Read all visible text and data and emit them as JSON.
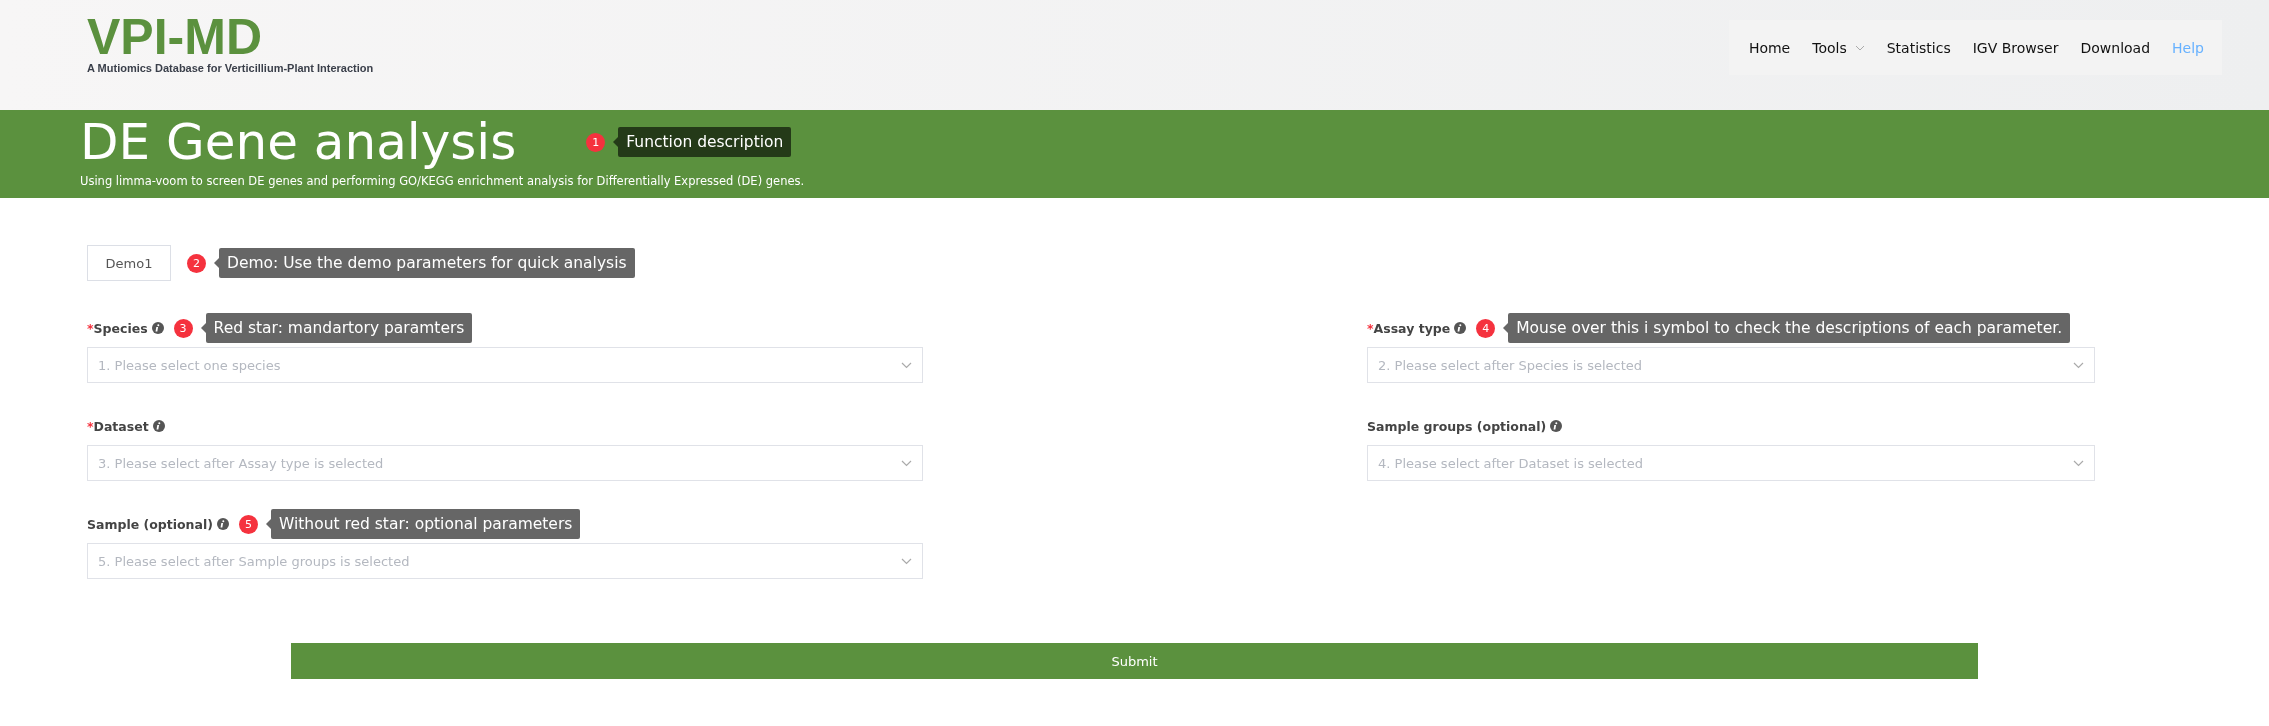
{
  "header": {
    "logo": "VPI-MD",
    "tagline": "A Mutiomics Database for Verticillium-Plant Interaction",
    "nav": [
      {
        "label": "Home",
        "kind": "link",
        "selected": false
      },
      {
        "label": "Tools",
        "kind": "dropdown",
        "selected": false
      },
      {
        "label": "Statistics",
        "kind": "link",
        "selected": false
      },
      {
        "label": "IGV Browser",
        "kind": "link",
        "selected": false
      },
      {
        "label": "Download",
        "kind": "link",
        "selected": false
      },
      {
        "label": "Help",
        "kind": "link",
        "selected": true
      }
    ]
  },
  "banner": {
    "title": "DE Gene analysis",
    "description": "Using limma-voom to screen DE genes and performing GO/KEGG enrichment analysis for Differentially Expressed (DE) genes.",
    "callout": {
      "number": "1",
      "text": "Function description"
    }
  },
  "demo": {
    "label": "Demo1",
    "callout": {
      "number": "2",
      "text": "Demo: Use the demo parameters for quick analysis"
    }
  },
  "fields": [
    {
      "marker": "*",
      "label": "Species",
      "placeholder": "1. Please select one species",
      "callout": {
        "number": "3",
        "text": "Red star: mandartory paramters"
      }
    },
    {
      "marker": "*",
      "label": "Assay type",
      "placeholder": "2. Please select after Species is selected",
      "callout": {
        "number": "4",
        "text": "Mouse over this i symbol to check the descriptions of each parameter."
      }
    },
    {
      "marker": "*",
      "label": "Dataset",
      "placeholder": "3. Please select after Assay type is selected"
    },
    {
      "label": "Sample groups (optional)",
      "placeholder": "4. Please select after Dataset is selected"
    },
    {
      "label": "Sample (optional)",
      "placeholder": "5. Please select after Sample groups is selected",
      "callout": {
        "number": "5",
        "text": "Without red star: optional parameters"
      }
    }
  ],
  "submit": {
    "label": "Submit"
  }
}
